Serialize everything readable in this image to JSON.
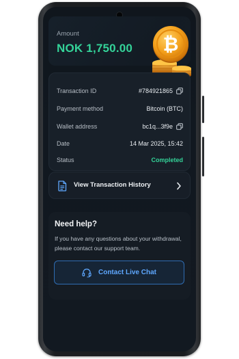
{
  "amount": {
    "label": "Amount",
    "value": "NOK 1,750.00"
  },
  "details": [
    {
      "label": "Transaction ID",
      "value": "#784921865",
      "copy_icon": "copy-icon"
    },
    {
      "label": "Payment method",
      "value": "Bitcoin (BTC)"
    },
    {
      "label": "Wallet address",
      "value": "bc1q...3f9e",
      "copy_icon": "copy-icon"
    },
    {
      "label": "Date",
      "value": "14 Mar 2025, 15:42"
    },
    {
      "label": "Status",
      "value": "Completed"
    }
  ],
  "history": {
    "label": "View Transaction History",
    "icon": "document-icon"
  },
  "help": {
    "title": "Need help?",
    "text": "If you have any questions about your withdrawal, please contact our support team.",
    "button_label": "Contact Live Chat",
    "button_icon": "headset-icon"
  },
  "colors": {
    "success": "#34d399",
    "accent": "#5fa8ff",
    "background": "#111820"
  }
}
